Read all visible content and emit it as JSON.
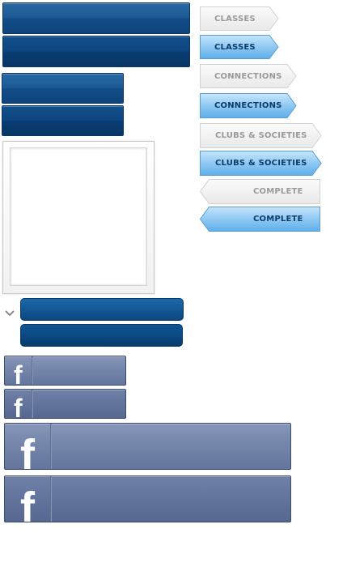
{
  "colors": {
    "blue_dark": "#0f447c",
    "tab_inactive_text": "#9a9a9a",
    "tab_active_text": "#0d3c6b",
    "tab_active_fill": "#8fc9f3",
    "facebook_blue": "#6b7ca3"
  },
  "tabs": {
    "classes_inactive": "CLASSES",
    "classes_active": "CLASSES",
    "connections_inactive": "CONNECTIONS",
    "connections_active": "CONNECTIONS",
    "clubs_inactive": "CLUBS & SOCIETIES",
    "clubs_active": "CLUBS & SOCIETIES",
    "complete_inactive": "COMPLETE",
    "complete_active": "COMPLETE"
  },
  "icons": {
    "facebook": "f",
    "chevron": "chevron-down-icon"
  }
}
